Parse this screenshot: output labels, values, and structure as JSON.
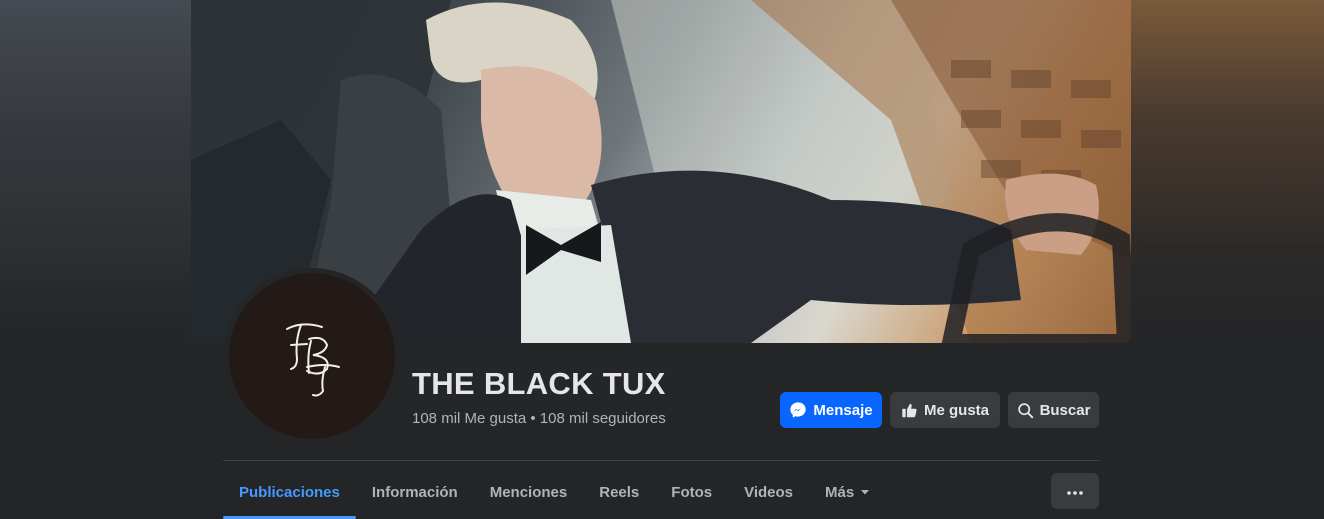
{
  "page": {
    "name": "THE BLACK TUX",
    "stats": "108 mil Me gusta • 108 mil seguidores",
    "logo_monogram": "FBT"
  },
  "actions": {
    "message_label": "Mensaje",
    "like_label": "Me gusta",
    "search_label": "Buscar"
  },
  "tabs": [
    {
      "label": "Publicaciones",
      "active": true
    },
    {
      "label": "Información",
      "active": false
    },
    {
      "label": "Menciones",
      "active": false
    },
    {
      "label": "Reels",
      "active": false
    },
    {
      "label": "Fotos",
      "active": false
    },
    {
      "label": "Videos",
      "active": false
    },
    {
      "label": "Más",
      "active": false
    }
  ],
  "icons": {
    "message": "messenger-icon",
    "like": "thumbs-up-icon",
    "search": "search-icon",
    "more_tab": "caret-down-icon",
    "overflow": "more-dots-icon"
  },
  "colors": {
    "accent": "#0866ff",
    "active_tab": "#4599ff",
    "background": "#242526",
    "secondary_button": "#3a3b3c"
  }
}
